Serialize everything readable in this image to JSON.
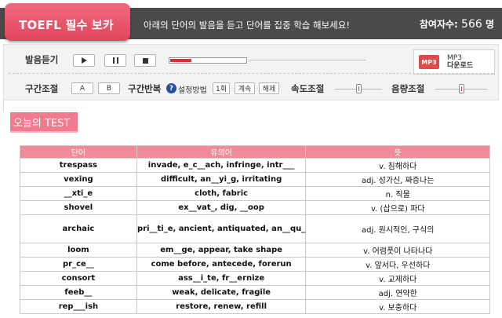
{
  "header": {
    "logo": "TOEFL 필수 보카",
    "description": "아래의 단어의 발음을 듣고 단어를 집중 학습 해보세요!",
    "participants_label": "참여자수:",
    "participants_count": "566",
    "participants_unit": "명"
  },
  "player": {
    "listen_label": "발음듣기",
    "progress": 0.28,
    "play_icon": "play-icon",
    "pause_icon": "pause-icon",
    "stop_icon": "stop-icon"
  },
  "mp3": {
    "icon_text": "MP3",
    "line1": "MP3",
    "line2": "다운로드"
  },
  "section_control": {
    "label": "구간조절",
    "a_button": "A",
    "b_button": "B"
  },
  "repeat_control": {
    "label": "구간반복",
    "help_icon": "?",
    "method_label": "설정방법",
    "once_button": "1회",
    "continuous_button": "계속",
    "release_button": "해제"
  },
  "speed_control": {
    "label": "속도조절",
    "level": 0.5
  },
  "volume_control": {
    "label": "음량조절",
    "level": 0.5
  },
  "today_test": {
    "label": "오늘의 TEST"
  },
  "table": {
    "headers": [
      "단어",
      "유의어",
      "뜻"
    ],
    "rows": [
      {
        "word": "trespass",
        "synonyms": "invade, e_c__ach, infringe, intr___",
        "meaning": "v. 침해하다"
      },
      {
        "word": "vexing",
        "synonyms": "difficult, an__yi_g, irritating",
        "meaning": "adj. 성가신, 짜증나는"
      },
      {
        "word": "__xti_e",
        "synonyms": "cloth, fabric",
        "meaning": "n. 직물"
      },
      {
        "word": "shovel",
        "synonyms": "ex__vat_, dig, __oop",
        "meaning": "v. (삽으로) 파다"
      },
      {
        "word": "archaic",
        "synonyms": "pri__ti_e, ancient, antiquated, an__qu_",
        "meaning": "adj. 원시적인, 구식의"
      },
      {
        "word": "loom",
        "synonyms": "em__ge, appear, take shape",
        "meaning": "v. 어렴풋이 나타나다"
      },
      {
        "word": "pr_ce__",
        "synonyms": "come before, antecede, forerun",
        "meaning": "v. 앞서다, 우선하다"
      },
      {
        "word": "consort",
        "synonyms": "ass__i_te, fr__ernize",
        "meaning": "v. 교제하다"
      },
      {
        "word": "feeb__",
        "synonyms": "weak, delicate, fragile",
        "meaning": "adj. 연약한"
      },
      {
        "word": "rep___ish",
        "synonyms": "restore, renew, refill",
        "meaning": "v. 보충하다"
      }
    ]
  }
}
